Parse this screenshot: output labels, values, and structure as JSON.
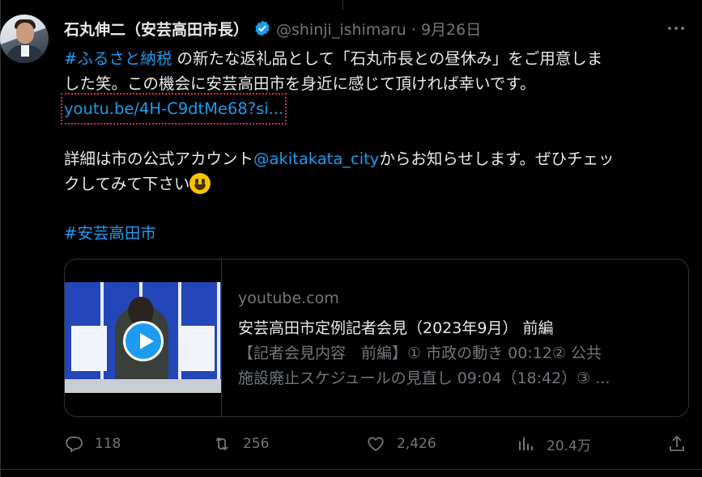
{
  "author": {
    "name": "石丸伸二（安芸高田市長）",
    "handle": "@shinji_ishimaru · 9月26日"
  },
  "tweet": {
    "hashtag1": "#ふるさと納税",
    "line1_rest": " の新たな返礼品として「石丸市長との昼休み」をご用意しま",
    "line2": "した笑。この機会に安芸高田市を身近に感じて頂ければ幸いです。",
    "url": "youtu.be/4H-C9dtMe68?si...",
    "para2_a": "詳細は市の公式アカウント",
    "mention": "@akitakata_city",
    "para2_b": "からお知らせします。ぜひチェッ",
    "para2_c": "クしてみて下さい",
    "hashtag2": "#安芸高田市"
  },
  "card": {
    "domain": "youtube.com",
    "title": "安芸高田市定例記者会見（2023年9月） 前編",
    "desc_line1": "【記者会見内容　前編】① 市政の動き 00:12② 公共",
    "desc_line2": "施設廃止スケジュールの見直し 09:04（18:42）③ ..."
  },
  "actions": {
    "replies": "118",
    "reposts": "256",
    "likes": "2,426",
    "views": "20.4万"
  },
  "colors": {
    "link": "#1d9bf0",
    "muted": "#71767b",
    "text": "#e7e9ea",
    "highlight_outline": "#e0245e"
  }
}
